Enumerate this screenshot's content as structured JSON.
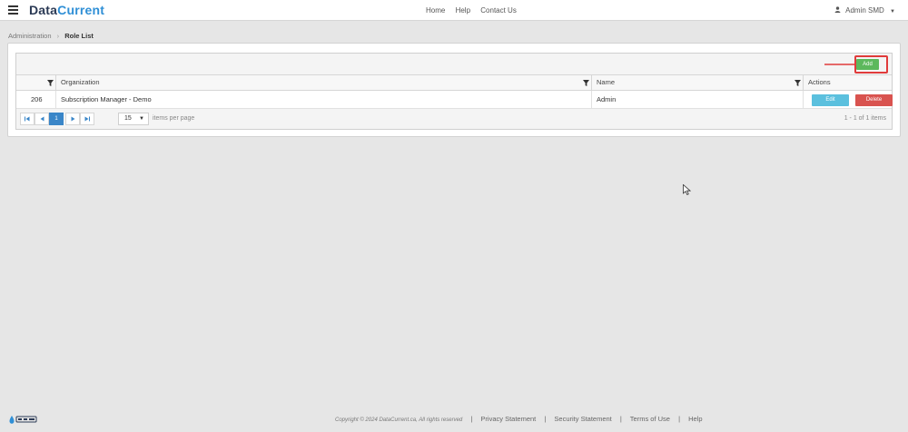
{
  "navbar": {
    "brand_part1": "Data",
    "brand_part2": "Current",
    "links": [
      "Home",
      "Help",
      "Contact Us"
    ],
    "user": "Admin SMD"
  },
  "breadcrumb": {
    "parent": "Administration",
    "separator": "›",
    "current": "Role List"
  },
  "toolbar": {
    "add_label": "Add"
  },
  "grid": {
    "columns": [
      "",
      "Organization",
      "Name",
      "Actions"
    ],
    "rows": [
      {
        "id": "206",
        "organization": "Subscription Manager - Demo",
        "name": "Admin",
        "edit_label": "Edit",
        "delete_label": "Delete"
      }
    ]
  },
  "pager": {
    "current_page": "1",
    "page_size": "15",
    "items_per_page_label": "items per page",
    "info": "1 - 1 of 1 items"
  },
  "footer": {
    "copyright": "Copyright © 2024 DataCurrent.ca, All rights reserved",
    "links": [
      "Privacy Statement",
      "Security Statement",
      "Terms of Use",
      "Help"
    ]
  },
  "colors": {
    "add": "#5cb85c",
    "edit": "#5bc0de",
    "delete": "#d9534f",
    "highlight": "#e03b3b",
    "accent": "#3a86c8"
  }
}
